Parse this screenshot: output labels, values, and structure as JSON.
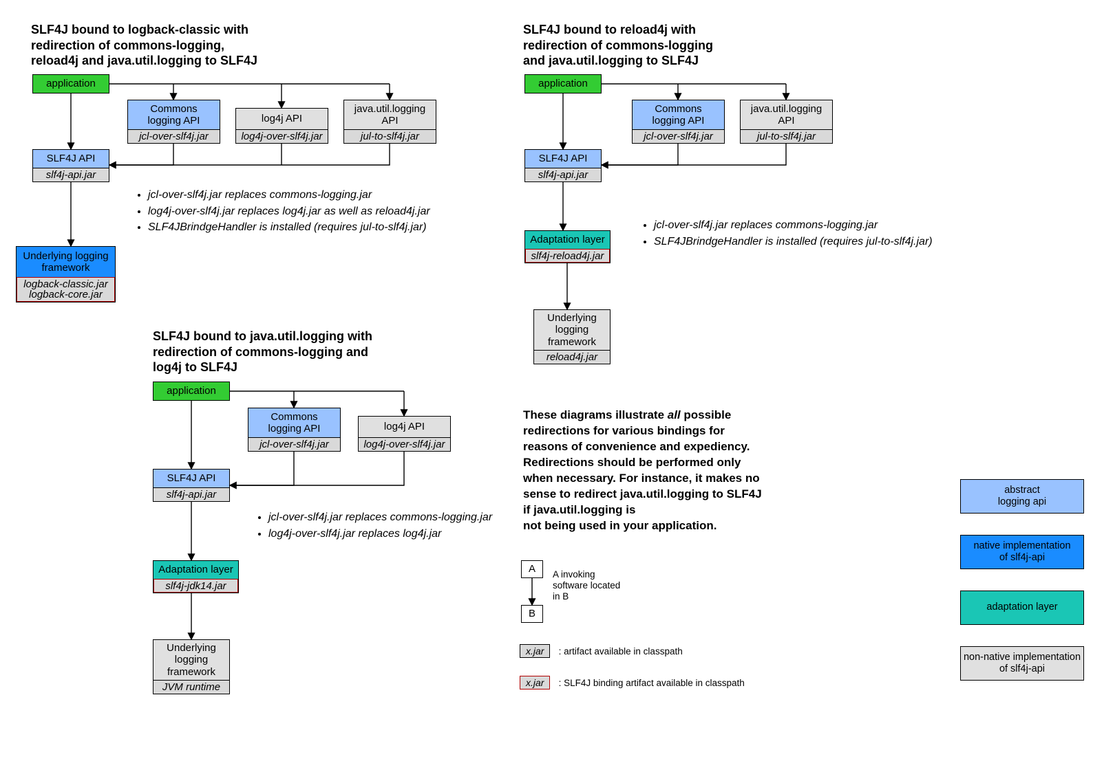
{
  "d1": {
    "title": "SLF4J bound to logback-classic with\nredirection of commons-logging,\nreload4j and java.util.logging to SLF4J",
    "app": "application",
    "commons": "Commons\nlogging API",
    "commons_jar": "jcl-over-slf4j.jar",
    "log4j": "log4j API",
    "log4j_jar": "log4j-over-slf4j.jar",
    "jul": "java.util.logging\nAPI",
    "jul_jar": "jul-to-slf4j.jar",
    "slf4j": "SLF4J API",
    "slf4j_jar": "slf4j-api.jar",
    "ulf": "Underlying logging\nframework",
    "ulf_jar": "logback-classic.jar\nlogback-core.jar",
    "n1": "jcl-over-slf4j.jar replaces commons-logging.jar",
    "n2": "log4j-over-slf4j.jar replaces log4j.jar as well as reload4j.jar",
    "n3": "SLF4JBrindgeHandler is installed (requires jul-to-slf4j.jar)"
  },
  "d2": {
    "title": "SLF4J bound to java.util.logging with\nredirection of commons-logging and\nlog4j to SLF4J",
    "app": "application",
    "commons": "Commons\nlogging API",
    "commons_jar": "jcl-over-slf4j.jar",
    "log4j": "log4j API",
    "log4j_jar": "log4j-over-slf4j.jar",
    "slf4j": "SLF4J API",
    "slf4j_jar": "slf4j-api.jar",
    "adapt": "Adaptation layer",
    "adapt_jar": "slf4j-jdk14.jar",
    "ulf": "Underlying\nlogging\nframework",
    "ulf_jar": "JVM runtime",
    "n1": "jcl-over-slf4j.jar replaces commons-logging.jar",
    "n2": "log4j-over-slf4j.jar replaces log4j.jar"
  },
  "d3": {
    "title": "SLF4J bound to reload4j with\nredirection of commons-logging\nand java.util.logging to SLF4J",
    "app": "application",
    "commons": "Commons\nlogging API",
    "commons_jar": "jcl-over-slf4j.jar",
    "jul": "java.util.logging\nAPI",
    "jul_jar": "jul-to-slf4j.jar",
    "slf4j": "SLF4J API",
    "slf4j_jar": "slf4j-api.jar",
    "adapt": "Adaptation layer",
    "adapt_jar": "slf4j-reload4j.jar",
    "ulf": "Underlying\nlogging\nframework",
    "ulf_jar": "reload4j.jar",
    "n1": "jcl-over-slf4j.jar replaces commons-logging.jar",
    "n2": "SLF4JBrindgeHandler is installed (requires jul-to-slf4j.jar)"
  },
  "explain": {
    "p1": "These diagrams illustrate ",
    "p1b": "all",
    "p2": " possible redirections for various bindings for reasons of convenience and expediency. Redirections should be performed only when necessary. For instance, it makes no sense to redirect java.util.logging to SLF4J if java.util.logging is",
    "p3": "not being used in your application."
  },
  "legend": {
    "A": "A",
    "B": "B",
    "AB": "A invoking\nsoftware located\nin B",
    "jar": "x.jar",
    "jar_txt": ": artifact available in classpath",
    "bjar": "x.jar",
    "bjar_txt": ": SLF4J binding artifact available in classpath",
    "l1": "abstract\nlogging api",
    "l2": "native implementation\nof slf4j-api",
    "l3": "adaptation layer",
    "l4": "non-native implementation\nof slf4j-api"
  }
}
